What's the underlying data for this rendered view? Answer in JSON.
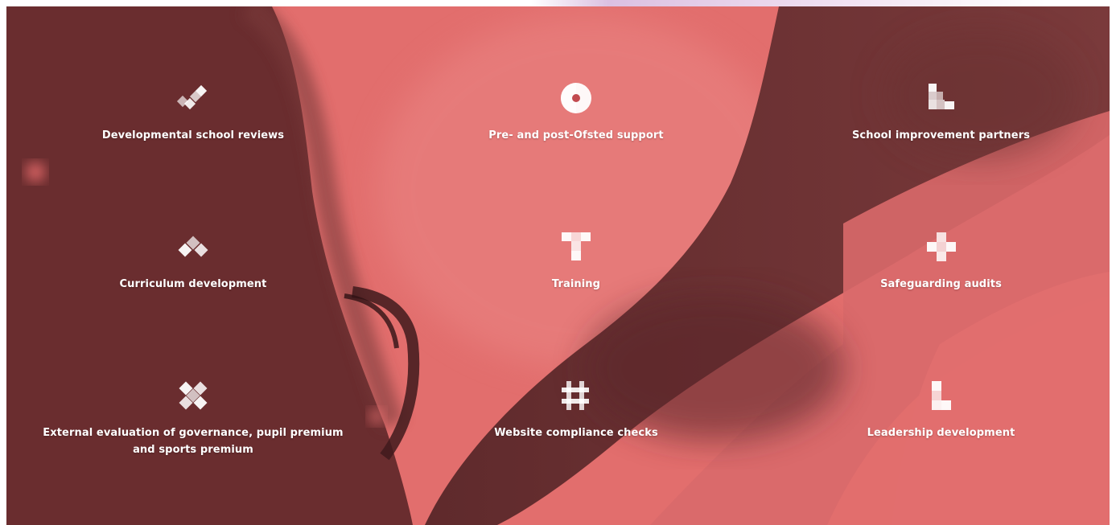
{
  "colors": {
    "overlay_light": "#e06c6c",
    "overlay_dark": "#6e2f31",
    "text": "#ffffff"
  },
  "services": [
    {
      "label": "Developmental school reviews",
      "icon": "check-icon"
    },
    {
      "label": "Pre- and post-Ofsted support",
      "icon": "target-circle-icon"
    },
    {
      "label": "School improvement partners",
      "icon": "blocks-icon"
    },
    {
      "label": "Curriculum development",
      "icon": "chevron-up-icon"
    },
    {
      "label": "Training",
      "icon": "letter-t-icon"
    },
    {
      "label": "Safeguarding audits",
      "icon": "plus-icon"
    },
    {
      "label": "External evaluation of governance, pupil premium and sports premium",
      "icon": "cross-icon"
    },
    {
      "label": "Website compliance checks",
      "icon": "hash-icon"
    },
    {
      "label": "Leadership development",
      "icon": "letter-l-icon"
    }
  ]
}
